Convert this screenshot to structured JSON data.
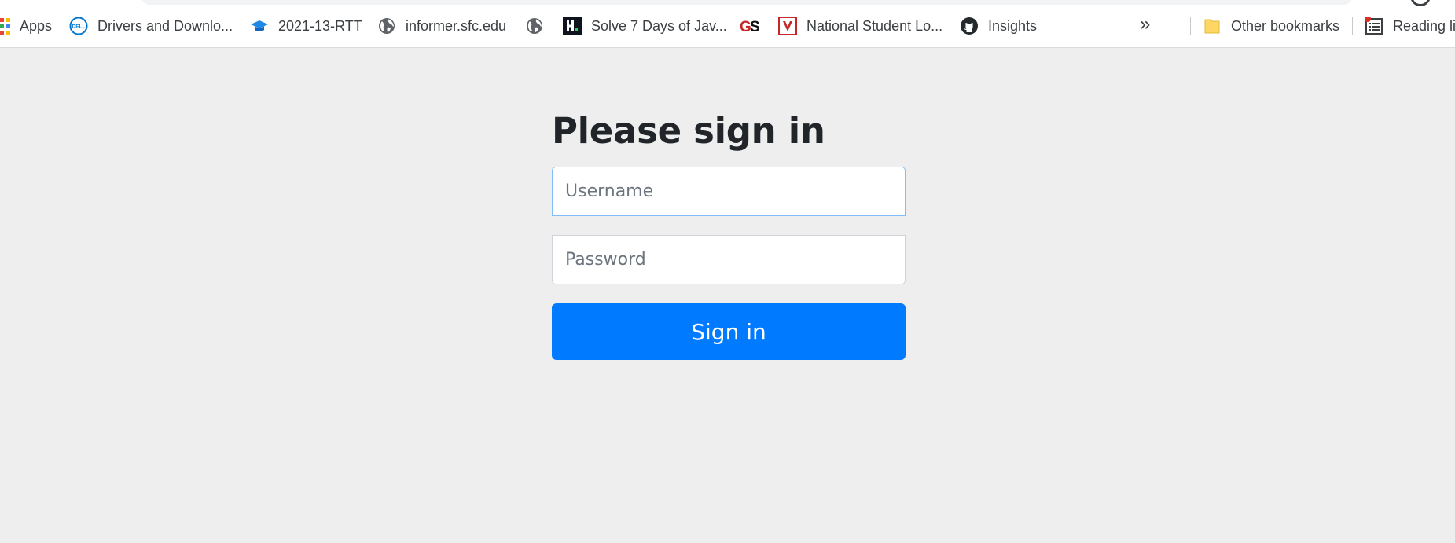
{
  "browser": {
    "bookmarks": [
      {
        "icon": "apps-grid-icon",
        "label": "Apps"
      },
      {
        "icon": "dell-logo-icon",
        "label": "Drivers and Downlo..."
      },
      {
        "icon": "graduation-cap-icon",
        "label": "2021-13-RTT"
      },
      {
        "icon": "globe-icon",
        "label": "informer.sfc.edu"
      },
      {
        "icon": "globe-icon",
        "label": ""
      },
      {
        "icon": "hackerrank-icon",
        "label": "Solve 7 Days of Jav..."
      },
      {
        "icon": "gs-logo-icon",
        "label": ""
      },
      {
        "icon": "v-logo-icon",
        "label": "National Student Lo..."
      },
      {
        "icon": "github-icon",
        "label": "Insights"
      }
    ],
    "overflow_label": "»",
    "other_bookmarks": {
      "icon": "folder-icon",
      "label": "Other bookmarks"
    },
    "reading_list": {
      "icon": "reading-list-icon",
      "label": "Reading li"
    },
    "colors": {
      "apps_grid": [
        "#ea4335",
        "#fbbc05",
        "#34a853",
        "#4285f4",
        "#ea4335",
        "#fbbc05"
      ],
      "dell_blue": "#0076ce",
      "folder_yellow": "#fdd663",
      "badge_red": "#d93025"
    }
  },
  "login": {
    "heading": "Please sign in",
    "username": {
      "value": "",
      "placeholder": "Username"
    },
    "password": {
      "value": "",
      "placeholder": "Password"
    },
    "submit_label": "Sign in",
    "colors": {
      "primary": "#007bff",
      "background": "#eeeeee",
      "heading": "#212529"
    }
  }
}
